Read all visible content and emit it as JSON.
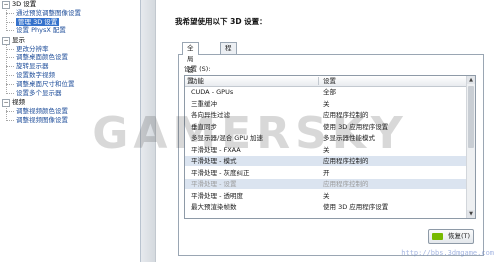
{
  "tree": {
    "categories": [
      {
        "label": "3D 设置",
        "items": [
          {
            "label": "通过预览调整图像设置",
            "selected": false
          },
          {
            "label": "管理 3D 设置",
            "selected": true
          },
          {
            "label": "设置 PhysX 配置",
            "selected": false
          }
        ]
      },
      {
        "label": "显示",
        "items": [
          {
            "label": "更改分辨率",
            "selected": false
          },
          {
            "label": "调整桌面颜色设置",
            "selected": false
          },
          {
            "label": "旋转显示器",
            "selected": false
          },
          {
            "label": "设置数字视频",
            "selected": false
          },
          {
            "label": "调整桌面尺寸和位置",
            "selected": false
          },
          {
            "label": "设置多个显示器",
            "selected": false
          }
        ]
      },
      {
        "label": "视频",
        "items": [
          {
            "label": "调整视频颜色设置",
            "selected": false
          },
          {
            "label": "调整视频图像设置",
            "selected": false
          }
        ]
      }
    ]
  },
  "heading": "我希望使用以下 3D 设置：",
  "tabs": [
    {
      "label": "全局设置",
      "active": true
    },
    {
      "label": "程序设置",
      "active": false
    }
  ],
  "settings_label": "设置 (S):",
  "list": {
    "columns": [
      "功能",
      "设置"
    ],
    "rows": [
      {
        "feature": "CUDA - GPUs",
        "value": "全部",
        "highlight": false,
        "dim": false
      },
      {
        "feature": "三重缓冲",
        "value": "关",
        "highlight": false,
        "dim": false
      },
      {
        "feature": "各向异性过滤",
        "value": "应用程序控制的",
        "highlight": false,
        "dim": false
      },
      {
        "feature": "垂直同步",
        "value": "使用 3D 应用程序设置",
        "highlight": false,
        "dim": false
      },
      {
        "feature": "多显示器/混合 GPU 加速",
        "value": "多显示器性能模式",
        "highlight": false,
        "dim": false
      },
      {
        "feature": "平滑处理 - FXAA",
        "value": "关",
        "highlight": false,
        "dim": false
      },
      {
        "feature": "平滑处理 - 模式",
        "value": "应用程序控制的",
        "highlight": true,
        "dim": false
      },
      {
        "feature": "平滑处理 - 灰度纠正",
        "value": "开",
        "highlight": false,
        "dim": false
      },
      {
        "feature": "平滑处理 - 设置",
        "value": "应用程序控制的",
        "highlight": true,
        "dim": true
      },
      {
        "feature": "平滑处理 - 透明度",
        "value": "关",
        "highlight": false,
        "dim": false
      },
      {
        "feature": "最大预渲染帧数",
        "value": "使用 3D 应用程序设置",
        "highlight": false,
        "dim": false
      }
    ]
  },
  "restore_button": "恢复(T)",
  "watermarks": {
    "main": "GAMERSKY",
    "url": "http://bbs.3dmgame.com"
  },
  "colors": {
    "selection": "#3572cc",
    "link": "#1f4e9a",
    "nvidia_green": "#76b900"
  }
}
